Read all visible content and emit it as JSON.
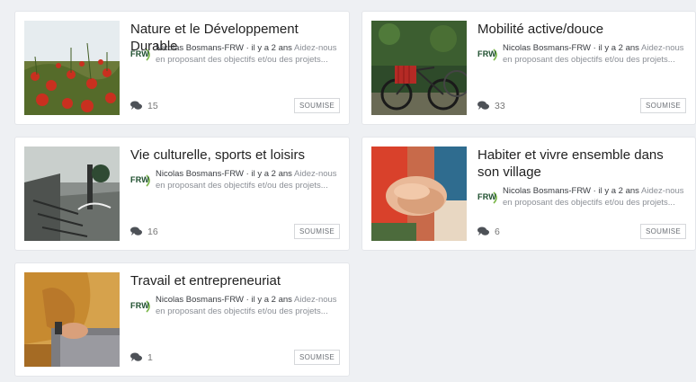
{
  "cards": [
    {
      "title": "Nature et le Développement Durable",
      "logo": "FRW",
      "author": "Nicolas Bosmans-FRW",
      "separator": "·",
      "time": "il y a 2 ans",
      "excerpt": "Aidez-nous en proposant des objectifs et/ou des projets...",
      "comments": "15",
      "status": "SOUMISE",
      "image_icon": "poppy-field-photo"
    },
    {
      "title": "Mobilité active/douce",
      "logo": "FRW",
      "author": "Nicolas Bosmans-FRW",
      "separator": "·",
      "time": "il y a 2 ans",
      "excerpt": "Aidez-nous en proposant des objectifs et/ou des projets...",
      "comments": "33",
      "status": "SOUMISE",
      "image_icon": "bicycles-photo"
    },
    {
      "title": "Vie culturelle, sports et loisirs",
      "logo": "FRW",
      "author": "Nicolas Bosmans-FRW",
      "separator": "·",
      "time": "il y a 2 ans",
      "excerpt": "Aidez-nous en proposant des objectifs et/ou des projets...",
      "comments": "16",
      "status": "SOUMISE",
      "image_icon": "skatepark-photo"
    },
    {
      "title": "Habiter et vivre ensemble dans son village",
      "logo": "FRW",
      "author": "Nicolas Bosmans-FRW",
      "separator": "·",
      "time": "il y a 2 ans",
      "excerpt": "Aidez-nous en proposant des objectifs et/ou des projets...",
      "comments": "6",
      "status": "SOUMISE",
      "image_icon": "stacked-hands-photo"
    },
    {
      "title": "Travail et entrepreneuriat",
      "logo": "FRW",
      "author": "Nicolas Bosmans-FRW",
      "separator": "·",
      "time": "il y a 2 ans",
      "excerpt": "Aidez-nous en proposant des objectifs et/ou des projets...",
      "comments": "1",
      "status": "SOUMISE",
      "image_icon": "laptop-work-photo"
    }
  ],
  "colors": {
    "background": "#eef0f3",
    "card": "#ffffff",
    "logo_green": "#1c4d2c",
    "logo_accent": "#7ab648"
  }
}
